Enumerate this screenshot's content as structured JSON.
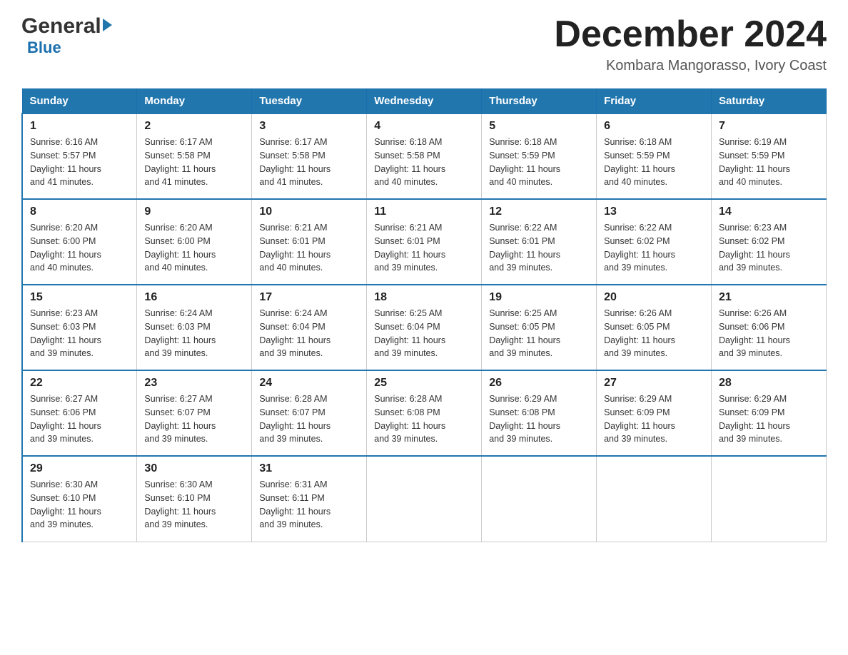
{
  "header": {
    "logo_general": "General",
    "logo_blue": "Blue",
    "month_title": "December 2024",
    "location": "Kombara Mangorasso, Ivory Coast"
  },
  "days_of_week": [
    "Sunday",
    "Monday",
    "Tuesday",
    "Wednesday",
    "Thursday",
    "Friday",
    "Saturday"
  ],
  "weeks": [
    [
      {
        "day": "1",
        "sunrise": "6:16 AM",
        "sunset": "5:57 PM",
        "daylight": "11 hours and 41 minutes."
      },
      {
        "day": "2",
        "sunrise": "6:17 AM",
        "sunset": "5:58 PM",
        "daylight": "11 hours and 41 minutes."
      },
      {
        "day": "3",
        "sunrise": "6:17 AM",
        "sunset": "5:58 PM",
        "daylight": "11 hours and 41 minutes."
      },
      {
        "day": "4",
        "sunrise": "6:18 AM",
        "sunset": "5:58 PM",
        "daylight": "11 hours and 40 minutes."
      },
      {
        "day": "5",
        "sunrise": "6:18 AM",
        "sunset": "5:59 PM",
        "daylight": "11 hours and 40 minutes."
      },
      {
        "day": "6",
        "sunrise": "6:18 AM",
        "sunset": "5:59 PM",
        "daylight": "11 hours and 40 minutes."
      },
      {
        "day": "7",
        "sunrise": "6:19 AM",
        "sunset": "5:59 PM",
        "daylight": "11 hours and 40 minutes."
      }
    ],
    [
      {
        "day": "8",
        "sunrise": "6:20 AM",
        "sunset": "6:00 PM",
        "daylight": "11 hours and 40 minutes."
      },
      {
        "day": "9",
        "sunrise": "6:20 AM",
        "sunset": "6:00 PM",
        "daylight": "11 hours and 40 minutes."
      },
      {
        "day": "10",
        "sunrise": "6:21 AM",
        "sunset": "6:01 PM",
        "daylight": "11 hours and 40 minutes."
      },
      {
        "day": "11",
        "sunrise": "6:21 AM",
        "sunset": "6:01 PM",
        "daylight": "11 hours and 39 minutes."
      },
      {
        "day": "12",
        "sunrise": "6:22 AM",
        "sunset": "6:01 PM",
        "daylight": "11 hours and 39 minutes."
      },
      {
        "day": "13",
        "sunrise": "6:22 AM",
        "sunset": "6:02 PM",
        "daylight": "11 hours and 39 minutes."
      },
      {
        "day": "14",
        "sunrise": "6:23 AM",
        "sunset": "6:02 PM",
        "daylight": "11 hours and 39 minutes."
      }
    ],
    [
      {
        "day": "15",
        "sunrise": "6:23 AM",
        "sunset": "6:03 PM",
        "daylight": "11 hours and 39 minutes."
      },
      {
        "day": "16",
        "sunrise": "6:24 AM",
        "sunset": "6:03 PM",
        "daylight": "11 hours and 39 minutes."
      },
      {
        "day": "17",
        "sunrise": "6:24 AM",
        "sunset": "6:04 PM",
        "daylight": "11 hours and 39 minutes."
      },
      {
        "day": "18",
        "sunrise": "6:25 AM",
        "sunset": "6:04 PM",
        "daylight": "11 hours and 39 minutes."
      },
      {
        "day": "19",
        "sunrise": "6:25 AM",
        "sunset": "6:05 PM",
        "daylight": "11 hours and 39 minutes."
      },
      {
        "day": "20",
        "sunrise": "6:26 AM",
        "sunset": "6:05 PM",
        "daylight": "11 hours and 39 minutes."
      },
      {
        "day": "21",
        "sunrise": "6:26 AM",
        "sunset": "6:06 PM",
        "daylight": "11 hours and 39 minutes."
      }
    ],
    [
      {
        "day": "22",
        "sunrise": "6:27 AM",
        "sunset": "6:06 PM",
        "daylight": "11 hours and 39 minutes."
      },
      {
        "day": "23",
        "sunrise": "6:27 AM",
        "sunset": "6:07 PM",
        "daylight": "11 hours and 39 minutes."
      },
      {
        "day": "24",
        "sunrise": "6:28 AM",
        "sunset": "6:07 PM",
        "daylight": "11 hours and 39 minutes."
      },
      {
        "day": "25",
        "sunrise": "6:28 AM",
        "sunset": "6:08 PM",
        "daylight": "11 hours and 39 minutes."
      },
      {
        "day": "26",
        "sunrise": "6:29 AM",
        "sunset": "6:08 PM",
        "daylight": "11 hours and 39 minutes."
      },
      {
        "day": "27",
        "sunrise": "6:29 AM",
        "sunset": "6:09 PM",
        "daylight": "11 hours and 39 minutes."
      },
      {
        "day": "28",
        "sunrise": "6:29 AM",
        "sunset": "6:09 PM",
        "daylight": "11 hours and 39 minutes."
      }
    ],
    [
      {
        "day": "29",
        "sunrise": "6:30 AM",
        "sunset": "6:10 PM",
        "daylight": "11 hours and 39 minutes."
      },
      {
        "day": "30",
        "sunrise": "6:30 AM",
        "sunset": "6:10 PM",
        "daylight": "11 hours and 39 minutes."
      },
      {
        "day": "31",
        "sunrise": "6:31 AM",
        "sunset": "6:11 PM",
        "daylight": "11 hours and 39 minutes."
      },
      null,
      null,
      null,
      null
    ]
  ],
  "labels": {
    "sunrise": "Sunrise:",
    "sunset": "Sunset:",
    "daylight": "Daylight:"
  }
}
